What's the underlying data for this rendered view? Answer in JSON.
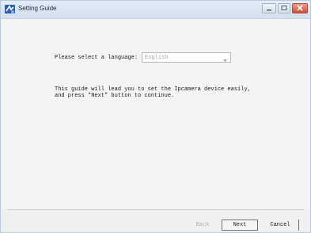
{
  "window": {
    "title": "Setting Guide"
  },
  "icons": {
    "app": "setting-guide-app-icon",
    "minimize": "minimize-icon",
    "maximize": "maximize-icon",
    "close": "close-icon",
    "dropdown": "chevron-down-icon"
  },
  "language": {
    "label": "Please select a language:",
    "selected": "English"
  },
  "description": {
    "line1": "This guide will lead you to set the Ipcamera device easily,",
    "line2": "and press \"Next\" button to continue."
  },
  "buttons": {
    "back": "Back",
    "next": "Next",
    "cancel": "Cancel"
  },
  "colors": {
    "close_button": "#c9513a",
    "window_background": "#f4f4f4",
    "disabled_text": "#b0b0b0"
  }
}
